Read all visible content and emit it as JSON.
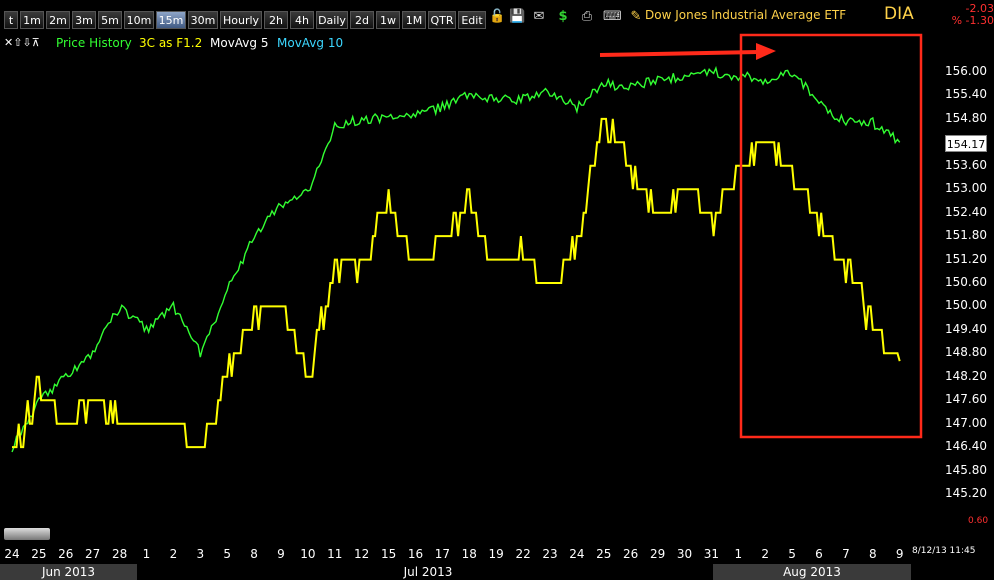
{
  "toolbar": {
    "timeframes": [
      "t",
      "1m",
      "2m",
      "3m",
      "5m",
      "10m",
      "15m",
      "30m",
      "Hourly",
      "2h",
      "4h",
      "Daily",
      "2d",
      "1w",
      "1M",
      "QTR",
      "Edit"
    ],
    "active": "15m"
  },
  "header": {
    "title": "Dow Jones Industrial Average ETF",
    "symbol": "DIA",
    "change": "-2.03",
    "change_pct": "% -1.30"
  },
  "legend": {
    "items": [
      {
        "label": "Price History",
        "color": "#32ff32"
      },
      {
        "label": "3C as F1.2",
        "color": "#ffff00"
      },
      {
        "label": "MovAvg 5",
        "color": "#ffffff"
      },
      {
        "label": "MovAvg 10",
        "color": "#3cd7ff"
      }
    ]
  },
  "price_badge": "154.17",
  "timestamp": "8/12/13 11:45",
  "sub_panel_value": "0.60",
  "colors": {
    "price": "#32ff32",
    "indicator": "#ffff00",
    "annotation": "#ff2a1a"
  },
  "chart_data": {
    "type": "line",
    "x": [
      "24",
      "25",
      "26",
      "27",
      "28",
      "1",
      "2",
      "3",
      "5",
      "8",
      "9",
      "10",
      "11",
      "12",
      "15",
      "16",
      "17",
      "18",
      "19",
      "22",
      "23",
      "24",
      "25",
      "26",
      "29",
      "30",
      "31",
      "1",
      "2",
      "5",
      "6",
      "7",
      "8",
      "9"
    ],
    "months": [
      "Jun 2013",
      "Jul 2013",
      "Aug 2013"
    ],
    "y_ticks": [
      145.2,
      145.8,
      146.4,
      147.0,
      147.6,
      148.2,
      148.8,
      149.4,
      150.0,
      150.6,
      151.2,
      151.8,
      152.4,
      153.0,
      153.6,
      154.2,
      154.8,
      155.4,
      156.0
    ],
    "y_tick_labels": [
      "145.20",
      "145.80",
      "146.40",
      "147.00",
      "147.60",
      "148.20",
      "148.80",
      "149.40",
      "150.00",
      "150.60",
      "151.20",
      "151.80",
      "152.40",
      "153.00",
      "153.60",
      "154.20",
      "154.80",
      "155.40",
      "156.00"
    ],
    "ylim": [
      144.9,
      156.5
    ],
    "series": [
      {
        "name": "Price History",
        "values": [
          146.4,
          147.6,
          148.2,
          148.8,
          150.0,
          149.4,
          150.0,
          148.8,
          150.4,
          151.8,
          152.6,
          152.9,
          154.6,
          154.8,
          154.8,
          154.9,
          155.1,
          155.4,
          155.3,
          155.3,
          155.5,
          155.1,
          155.7,
          155.6,
          155.8,
          155.9,
          156.0,
          155.9,
          155.8,
          156.0,
          155.2,
          154.7,
          154.7,
          154.2
        ]
      },
      {
        "name": "3C as F1.2",
        "values": [
          146.2,
          147.8,
          147.0,
          147.6,
          147.2,
          146.8,
          147.0,
          146.0,
          148.4,
          149.6,
          150.2,
          148.2,
          150.8,
          151.2,
          152.8,
          151.0,
          151.6,
          152.6,
          151.0,
          151.4,
          150.4,
          151.6,
          154.8,
          153.6,
          152.4,
          153.0,
          152.2,
          153.6,
          154.4,
          153.4,
          152.2,
          151.0,
          149.6,
          148.6
        ]
      }
    ],
    "xlabel": "",
    "ylabel": "",
    "grid": false
  }
}
